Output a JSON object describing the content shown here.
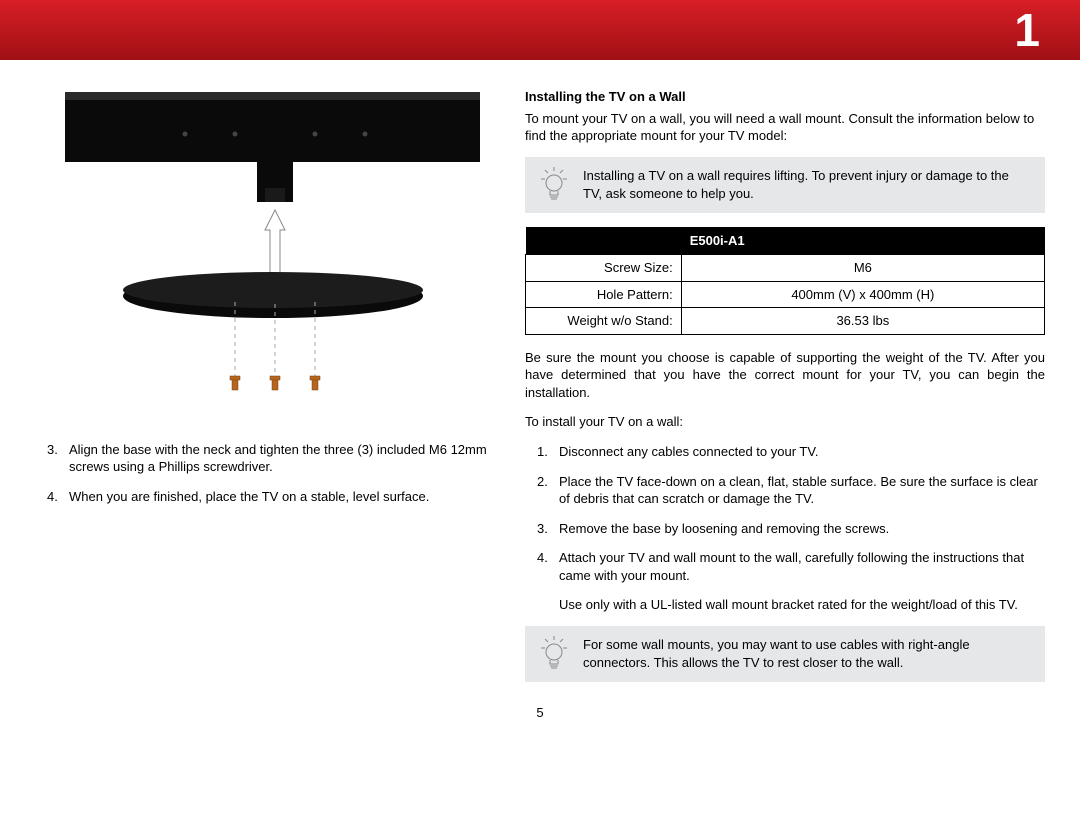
{
  "header": {
    "chapter_number": "1"
  },
  "page_number": "5",
  "left": {
    "steps": [
      {
        "num": "3",
        "text": "Align the base with the neck and tighten the three (3) included M6 12mm screws using a Phillips screwdriver."
      },
      {
        "num": "4",
        "text": "When you are finished, place the TV on a stable, level surface."
      }
    ]
  },
  "right": {
    "title": "Installing the TV on a Wall",
    "intro": "To mount your TV on a wall, you will need a wall mount. Consult the information below to find the appropriate mount for your TV model:",
    "tip1": "Installing a TV on a wall requires lifting. To prevent injury or damage to the TV, ask someone to help you.",
    "table": {
      "model": "E500i-A1",
      "rows": [
        {
          "label": "Screw Size:",
          "value": "M6"
        },
        {
          "label": "Hole Pattern:",
          "value": "400mm (V) x 400mm (H)"
        },
        {
          "label": "Weight w/o Stand:",
          "value": "36.53 lbs"
        }
      ]
    },
    "mount_para": "Be sure the mount you choose is capable of supporting the weight of the TV. After you have determined that you have the correct mount for your TV, you can begin the installation.",
    "install_intro": "To install your TV on a wall:",
    "install_steps": [
      {
        "num": "1",
        "text": "Disconnect any cables connected to your TV."
      },
      {
        "num": "2",
        "text": "Place the TV face-down on a clean, flat, stable surface. Be sure the surface is clear of debris that can scratch or damage the TV."
      },
      {
        "num": "3",
        "text": "Remove the base by loosening and removing the screws."
      },
      {
        "num": "4",
        "text": "Attach your TV and wall mount to the wall, carefully following the instructions that came with your mount."
      }
    ],
    "ul_note": "Use only with a UL-listed wall mount bracket rated for the weight/load of this TV.",
    "tip2": "For some wall mounts, you may want to use cables with right-angle connectors. This allows the TV to rest closer to the wall."
  }
}
